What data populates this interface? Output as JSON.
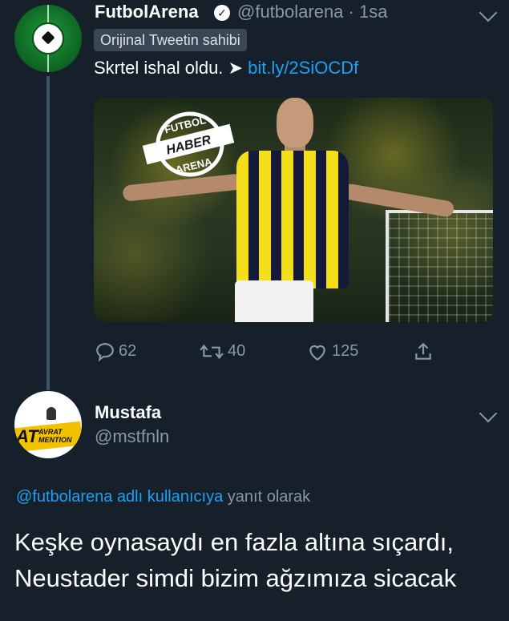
{
  "colors": {
    "background": "#15202b",
    "link": "#1da1f2",
    "muted": "#8899a6",
    "text": "#ffffff"
  },
  "tweet": {
    "author_name": "FutbolArena",
    "verified_icon": "verified-badge-icon",
    "handle_time": "@futbolarena · 1sa",
    "badge": "Orijinal Tweetin sahibi",
    "text": "Skrtel ishal oldu. ➤ ",
    "link": "bit.ly/2SiOCDf",
    "media_logo": [
      "FUTBOL",
      "HABER",
      "ARENA"
    ],
    "actions": {
      "reply_count": "62",
      "retweet_count": "40",
      "like_count": "125"
    }
  },
  "reply": {
    "author_name": "Mustafa",
    "handle": "@mstfnln",
    "avatar_text_big": "AT",
    "avatar_text_small_1": "AVRAT",
    "avatar_text_small_2": "MENTION",
    "replying_to_mention": "@futbolarena adlı kullanıcıya",
    "replying_to_suffix": " yanıt olarak",
    "line1": "Keşke oynasaydı en fazla altına sıçardı,",
    "line2": "Neustader simdi bizim ağzımıza sicacak"
  }
}
